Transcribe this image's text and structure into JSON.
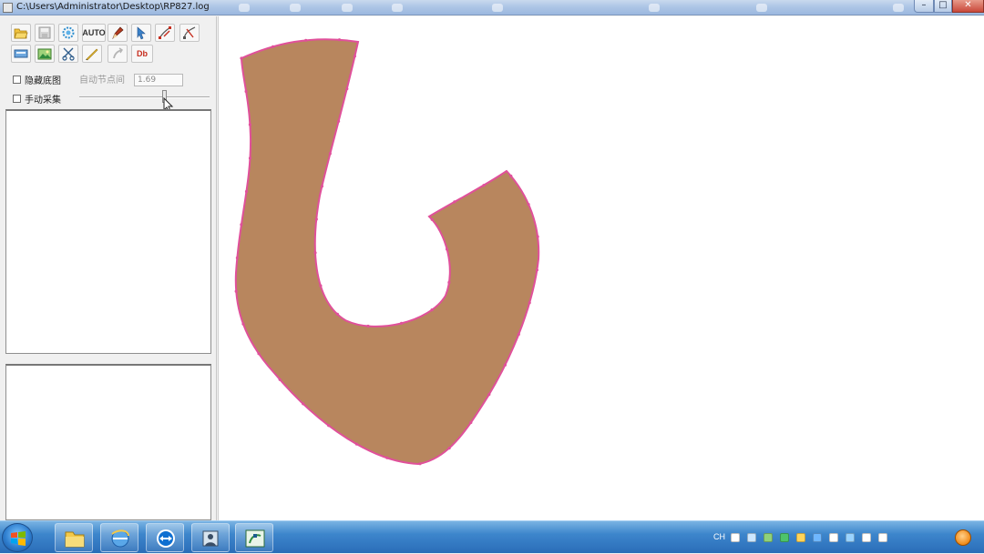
{
  "window": {
    "title": "C:\\Users\\Administrator\\Desktop\\RP827.log",
    "controls": {
      "minimize": "–",
      "maximize": "□",
      "close": "✕"
    }
  },
  "toolbar": {
    "row1": [
      {
        "name": "open-folder-icon",
        "type": "icon"
      },
      {
        "name": "save-icon",
        "type": "icon"
      },
      {
        "name": "settings-gear-icon",
        "type": "icon"
      },
      {
        "name": "auto-button",
        "type": "text",
        "label": "AUTO"
      },
      {
        "name": "pen-edit-icon",
        "type": "icon"
      },
      {
        "name": "pointer-select-icon",
        "type": "icon"
      },
      {
        "name": "draw-node-icon",
        "type": "icon"
      },
      {
        "name": "draw-curve-icon",
        "type": "icon"
      }
    ],
    "row2": [
      {
        "name": "scan-image-icon",
        "type": "icon"
      },
      {
        "name": "picture-icon",
        "type": "icon"
      },
      {
        "name": "cut-scissors-icon",
        "type": "icon"
      },
      {
        "name": "ruler-pencil-icon",
        "type": "icon"
      },
      {
        "name": "undo-icon",
        "type": "icon"
      },
      {
        "name": "db-button",
        "type": "text",
        "label": "Db"
      }
    ]
  },
  "options": {
    "checkbox1_label": "隐藏底图",
    "checkbox2_label": "手动采集",
    "auto_label": "自动节点间",
    "auto_value": "1.69",
    "slider_value": 0.66
  },
  "canvas": {
    "shape_fill": "#b8865e",
    "shape_stroke": "#e0509a",
    "background": "#ffffff"
  },
  "taskbar": {
    "items": [
      "explorer-icon",
      "ie-browser-icon",
      "teamviewer-icon",
      "user-app-icon",
      "vector-app-icon"
    ],
    "tray_text": "CH",
    "tray_colors": [
      "#ffffff",
      "#cde7ff",
      "#8fd17a",
      "#4dc36b",
      "#ffd45a",
      "#6fb7ff",
      "#ffffff",
      "#9ad3ff",
      "#ffffff",
      "#ffffff"
    ]
  }
}
